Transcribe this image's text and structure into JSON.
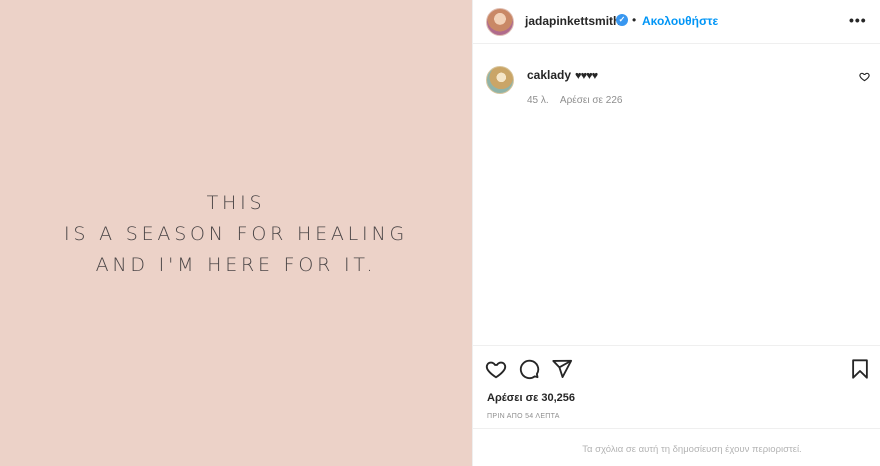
{
  "post": {
    "image_text_lines": [
      "THIS",
      "IS A SEASON FOR HEALING",
      "AND I'M HERE FOR IT."
    ],
    "background_color": "#ecd2c8"
  },
  "header": {
    "owner_username": "jadapinkettsmith",
    "verified_icon": "verified-badge-icon",
    "separator": "•",
    "follow_label": "Ακολουθήστε",
    "more_icon": "•••"
  },
  "comments": [
    {
      "username": "caklady",
      "text": "♥♥♥♥",
      "age": "45 λ.",
      "likes_label": "Αρέσει σε 226"
    }
  ],
  "actions": {
    "like_icon": "heart-icon",
    "comment_icon": "comment-icon",
    "share_icon": "paper-plane-icon",
    "save_icon": "bookmark-icon"
  },
  "likes_label": "Αρέσει σε 30,256",
  "timestamp": "ΠΡΙΝ ΑΠΟ 54 ΛΕΠΤΑ",
  "comments_limited": "Τα σχόλια σε αυτή τη δημοσίευση έχουν περιοριστεί.",
  "colors": {
    "accent": "#0095f6",
    "verified": "#3897f0",
    "muted": "#8e8e8e"
  }
}
